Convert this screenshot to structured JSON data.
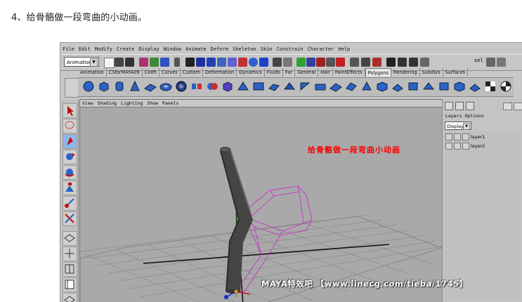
{
  "step_title": "4、给骨骼做一段弯曲的小动画。",
  "menubar": {
    "items": [
      "File",
      "Edit",
      "Modify",
      "Create",
      "Display",
      "Window",
      "Animate",
      "Deform",
      "Skeleton",
      "Skin",
      "Constrain",
      "Character",
      "Help"
    ]
  },
  "status_line": {
    "mode_select": "Animation",
    "sel_label": "sel"
  },
  "shelf_tabs": [
    "Animation",
    "CSforMAYA09",
    "Cloth",
    "Curves",
    "Custom",
    "Deformation",
    "Dynamics",
    "Fluids",
    "Fur",
    "General",
    "Hair",
    "PaintEffects",
    "Polygons",
    "Rendering",
    "Subdivs",
    "Surfaces"
  ],
  "active_shelf_tab": "Polygons",
  "viewport": {
    "menu": [
      "View",
      "Shading",
      "Lighting",
      "Show",
      "Panels"
    ],
    "overlay_title": "给骨骼做一段弯曲小动画"
  },
  "layer_panel": {
    "menu": [
      "Layers",
      "Options"
    ],
    "display_select": "Display",
    "layers": [
      "layer1",
      "layer2"
    ]
  },
  "watermark": "MAYA特效吧 【www.linecg.com/tieba/1745】",
  "colors": {
    "accent_red": "#ff0000",
    "wire_magenta": "#d020d0",
    "viewport_bg": "#a9a9a9"
  }
}
